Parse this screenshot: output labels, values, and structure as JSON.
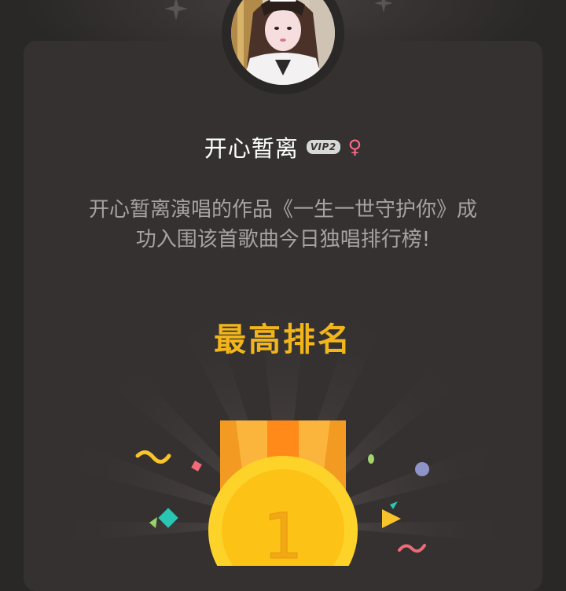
{
  "user": {
    "name": "开心暂离",
    "vip_badge": "VIP2",
    "gender_symbol": "♀"
  },
  "announcement": {
    "line1": "开心暂离演唱的作品《一生一世守护你》成",
    "line2": "功入围该首歌曲今日独唱排行榜!"
  },
  "ranking": {
    "title": "最高排名",
    "rank": "1"
  },
  "colors": {
    "background": "#2a2727",
    "card": "#353131",
    "title_gold": "#f2b61b",
    "medal_gold": "#fdd32a",
    "ribbon_orange": "#f7a530",
    "gender_pink": "#ff6b8a",
    "text_gray": "#a7a3a1"
  }
}
